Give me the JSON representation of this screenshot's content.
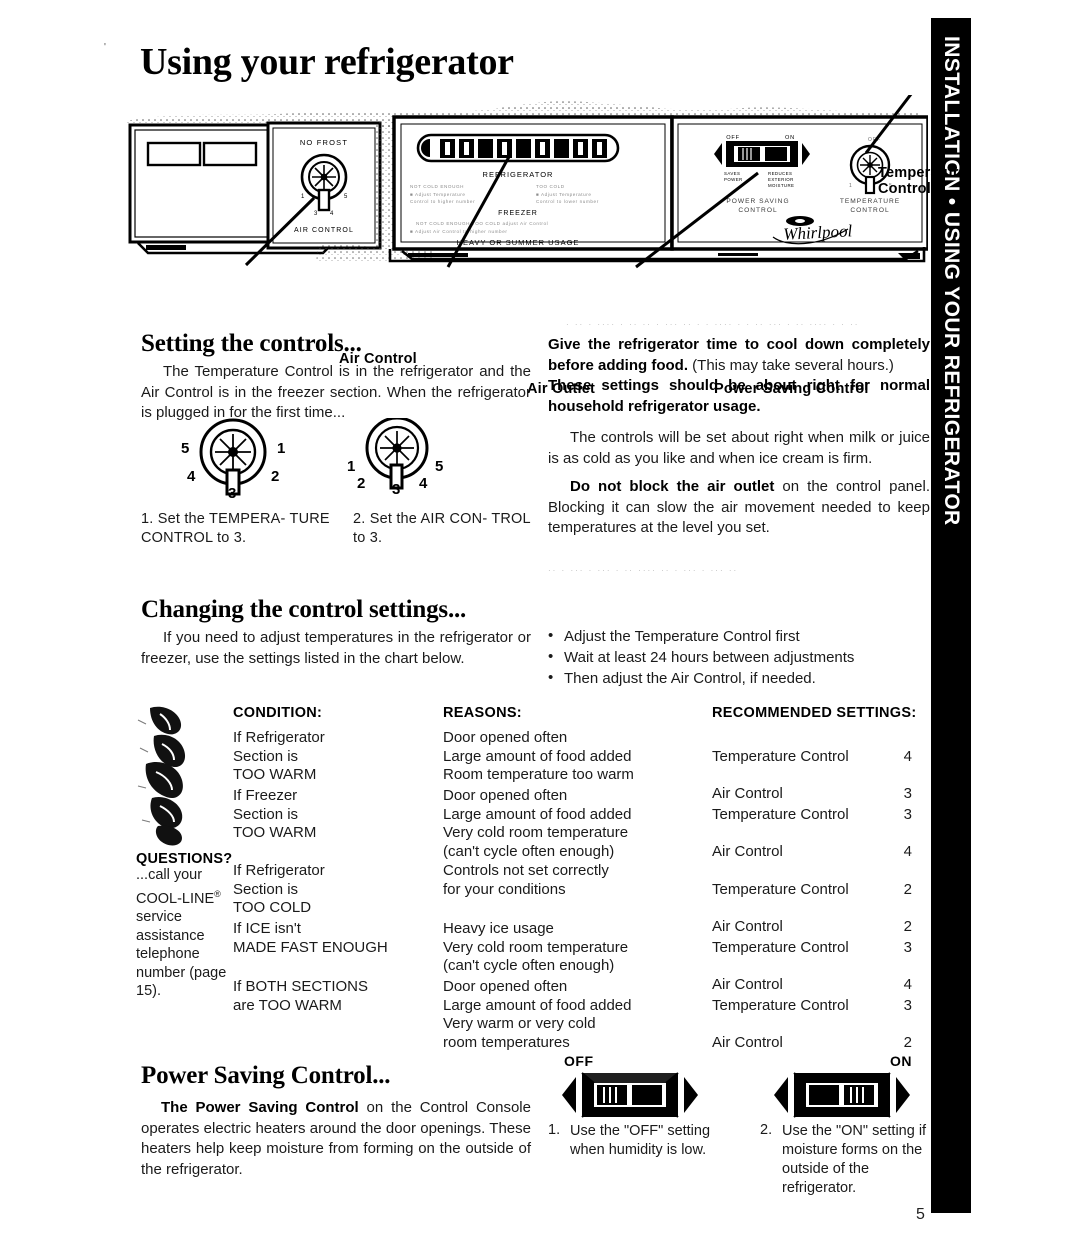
{
  "page": {
    "title": "Using your refrigerator",
    "page_number": "5",
    "side_tab": "INSTALLATION • USING YOUR REFRIGERATOR"
  },
  "illustration": {
    "callouts": {
      "temperature_control": "Temperature Control",
      "air_control": "Air Control",
      "air_outlet": "Air Outlet",
      "power_saving_control": "Power Saving Control"
    },
    "left_panel": {
      "top_label": "NO FROST",
      "bottom_label": "AIR CONTROL",
      "dial_ticks": [
        "1",
        "3",
        "4",
        "5"
      ]
    },
    "center_panel": {
      "headings": [
        "REFRIGERATOR",
        "FREEZER",
        "HEAVY OR SUMMER USAGE"
      ]
    },
    "right_panel": {
      "switch_off": "OFF",
      "switch_on": "ON",
      "switch_left_note": "SAVES POWER",
      "switch_right_note": "REDUCES EXTERIOR MOISTURE",
      "power_label": "POWER SAVING CONTROL",
      "temp_label": "TEMPERATURE CONTROL",
      "brand": "Whirlpool",
      "dial_top_label": "OFF"
    }
  },
  "setting": {
    "heading": "Setting the controls...",
    "paragraph": "The Temperature Control is in the refrigerator and the Air Control is in the freezer section. When the refrigerator is plugged in for the first time...",
    "dial_1": {
      "labels": [
        "5",
        "1",
        "4",
        "2",
        "3"
      ],
      "caption": "1. Set the TEMPERA-\nTURE CONTROL to 3."
    },
    "dial_2": {
      "labels": [
        "1",
        "5",
        "2",
        "4",
        "3"
      ],
      "caption": "2. Set the AIR CON-\nTROL to 3."
    },
    "right_bold_1": "Give the refrigerator time to cool down completely before adding food.",
    "right_rest_1": " (This may take several hours.)",
    "right_bold_2": "These settings should be about right for normal household refrigerator usage.",
    "right_para_3": "The controls will be set about right when milk or juice is as cold as you like and when ice cream is firm.",
    "right_bold_3": "Do not block the air outlet",
    "right_rest_3": " on the control panel. Blocking it can slow the air movement needed to keep temperatures at the level you set."
  },
  "changing": {
    "heading": "Changing the control settings...",
    "paragraph": "If you need to adjust temperatures in the refrigerator or freezer, use the settings listed in the chart below.",
    "bullets": [
      "Adjust the Temperature Control first",
      "Wait at least 24 hours between adjustments",
      "Then adjust the Air Control, if needed."
    ]
  },
  "chart_data": {
    "type": "table",
    "title": "Changing the control settings",
    "columns": [
      "CONDITION:",
      "REASONS:",
      "RECOMMENDED SETTINGS:"
    ],
    "rows": [
      {
        "condition": "If Refrigerator\nSection is\nTOO WARM",
        "reasons": "Door opened often\nLarge amount of food added\nRoom temperature too warm",
        "settings": [
          {
            "control": "Temperature Control",
            "value": "4"
          },
          {
            "control": "Air Control",
            "value": "3"
          }
        ]
      },
      {
        "condition": "If Freezer\nSection is\nTOO WARM",
        "reasons": "Door opened often\nLarge amount of food added\nVery cold room temperature\n(can't cycle often enough)",
        "settings": [
          {
            "control": "Temperature Control",
            "value": "3"
          },
          {
            "control": "Air Control",
            "value": "4"
          }
        ]
      },
      {
        "condition": "If Refrigerator\nSection is\nTOO COLD",
        "reasons": "Controls not set correctly\nfor your conditions",
        "settings": [
          {
            "control": "Temperature Control",
            "value": "2"
          },
          {
            "control": "Air Control",
            "value": "2"
          }
        ]
      },
      {
        "condition": "If ICE isn't\nMADE FAST ENOUGH",
        "reasons": "Heavy ice usage\nVery cold room temperature\n(can't cycle often enough)",
        "settings": [
          {
            "control": "Temperature Control",
            "value": "3"
          },
          {
            "control": "Air Control",
            "value": "4"
          }
        ]
      },
      {
        "condition": "If BOTH SECTIONS\nare TOO WARM",
        "reasons": "Door opened often\nLarge amount of food added\nVery warm or very cold\nroom temperatures",
        "settings": [
          {
            "control": "Temperature Control",
            "value": "3"
          },
          {
            "control": "Air Control",
            "value": "2"
          }
        ]
      }
    ]
  },
  "questions": {
    "title": "QUESTIONS?",
    "line_1": "...call your",
    "brand": "COOL-LINE",
    "registered": "®",
    "rest": "service assistance telephone number (page 15)."
  },
  "power_saving": {
    "heading": "Power Saving Control...",
    "bold_lead": "The Power Saving Control",
    "paragraph": " on the Control Console operates electric heaters around the door openings. These heaters help keep moisture from forming on the outside of the refrigerator.",
    "switch_off_label": "OFF",
    "switch_on_label": "ON",
    "step_1_number": "1.",
    "step_1_text": "Use the \"OFF\" setting when humidity is low.",
    "step_2_number": "2.",
    "step_2_text": "Use the \"ON\" setting if moisture forms on the outside of the refrigerator."
  },
  "ghost_text": {
    "line_a": "· ·· · ···· · ··  ·· · ··· ·· · · ···· · · ·· ···  · ·· ···· · · ··",
    "line_b": "··  · ··· ·  ··· · ··  ···· ·· · ···  · ··· ··"
  },
  "colors": {
    "ink": "#111111",
    "tab_background": "#000000",
    "tab_text": "#ffffff",
    "paper": "#ffffff"
  }
}
